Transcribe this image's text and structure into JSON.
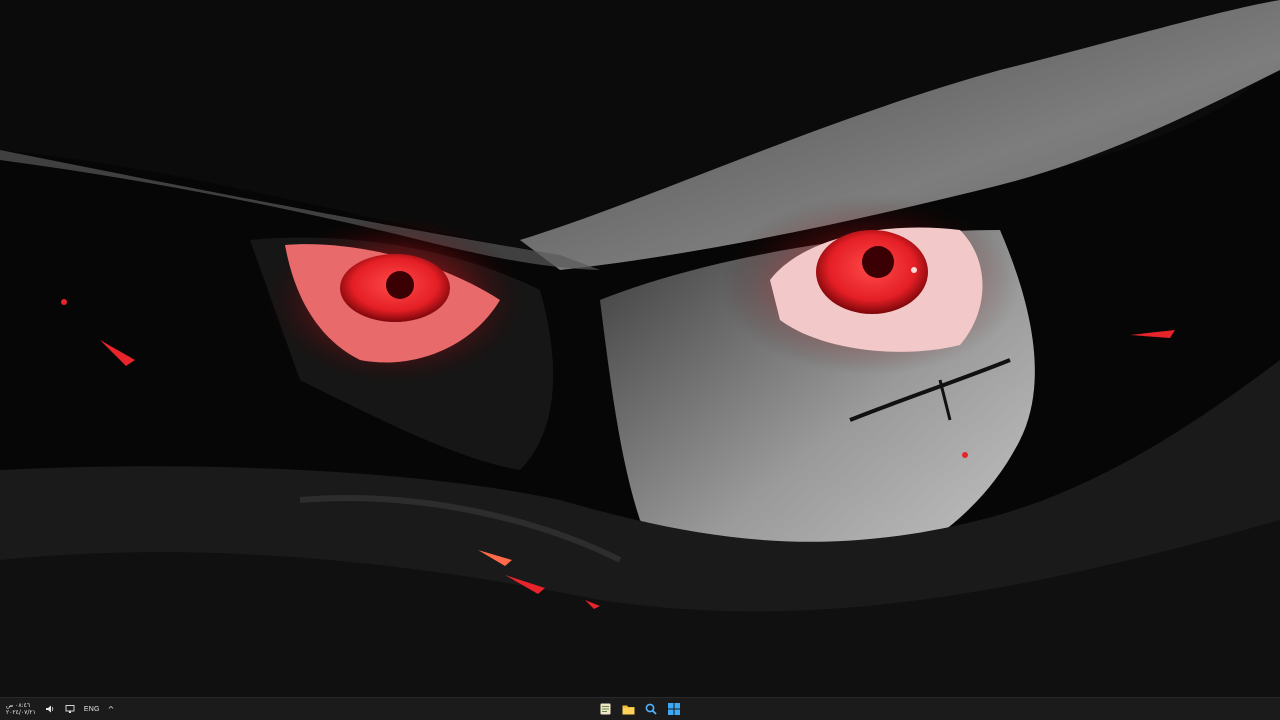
{
  "wallpaper": {
    "subject": "anime-character-red-eyes-icon",
    "accent_red": "#e8242b",
    "shadow": "#050505"
  },
  "taskbar": {
    "background": "#1b1b1b",
    "clock": {
      "time": "٠٨:٤٦ ص",
      "date": "٢٠٢٤/٠٧/٢١"
    },
    "language": "ENG",
    "chevron": "^",
    "tray_icons": [
      "volume-icon",
      "network-icon"
    ],
    "pinned_apps": [
      "notepad-icon",
      "file-explorer-icon",
      "search-icon",
      "start-icon"
    ]
  }
}
